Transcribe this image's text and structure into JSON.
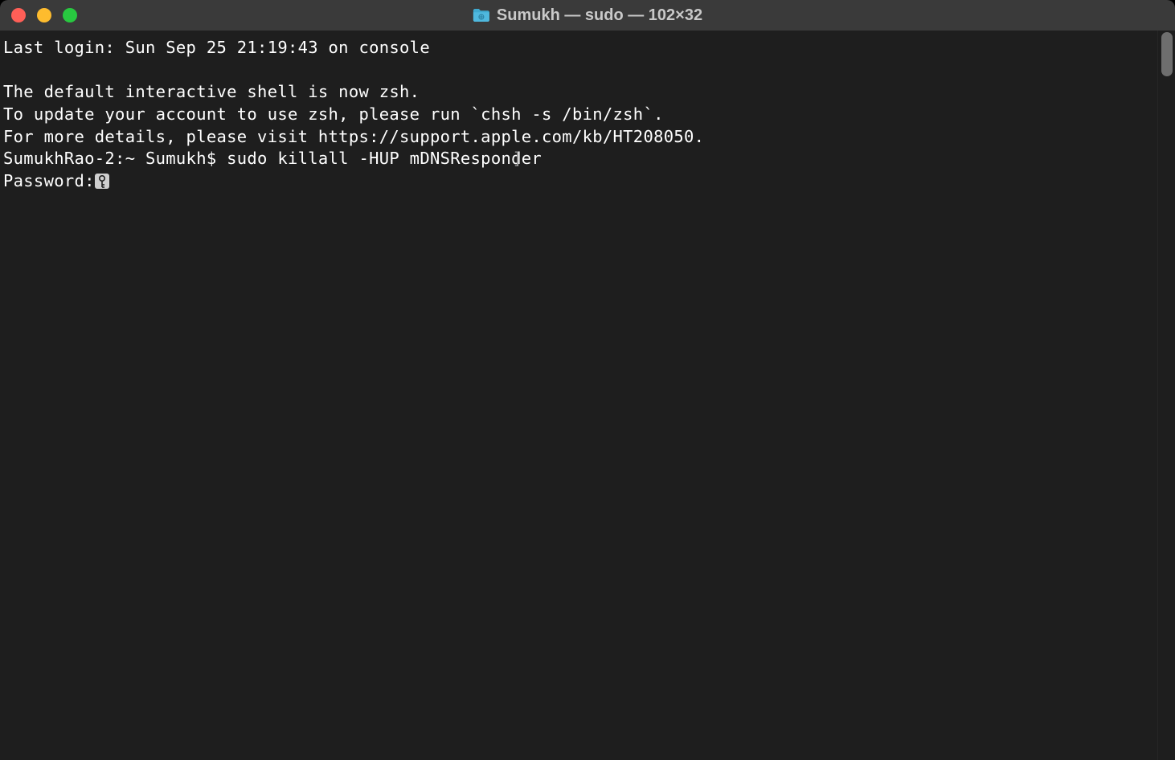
{
  "titlebar": {
    "title": "Sumukh — sudo — 102×32"
  },
  "terminal": {
    "last_login": "Last login: Sun Sep 25 21:19:43 on console",
    "blank": "",
    "zsh_notice_1": "The default interactive shell is now zsh.",
    "zsh_notice_2": "To update your account to use zsh, please run `chsh -s /bin/zsh`.",
    "zsh_notice_3": "For more details, please visit https://support.apple.com/kb/HT208050.",
    "prompt_prefix": "SumukhRao-2:~ Sumukh$ ",
    "command": "sudo killall -HUP mDNSResponder",
    "prompt_bracket": "]",
    "password_label": "Password:"
  }
}
